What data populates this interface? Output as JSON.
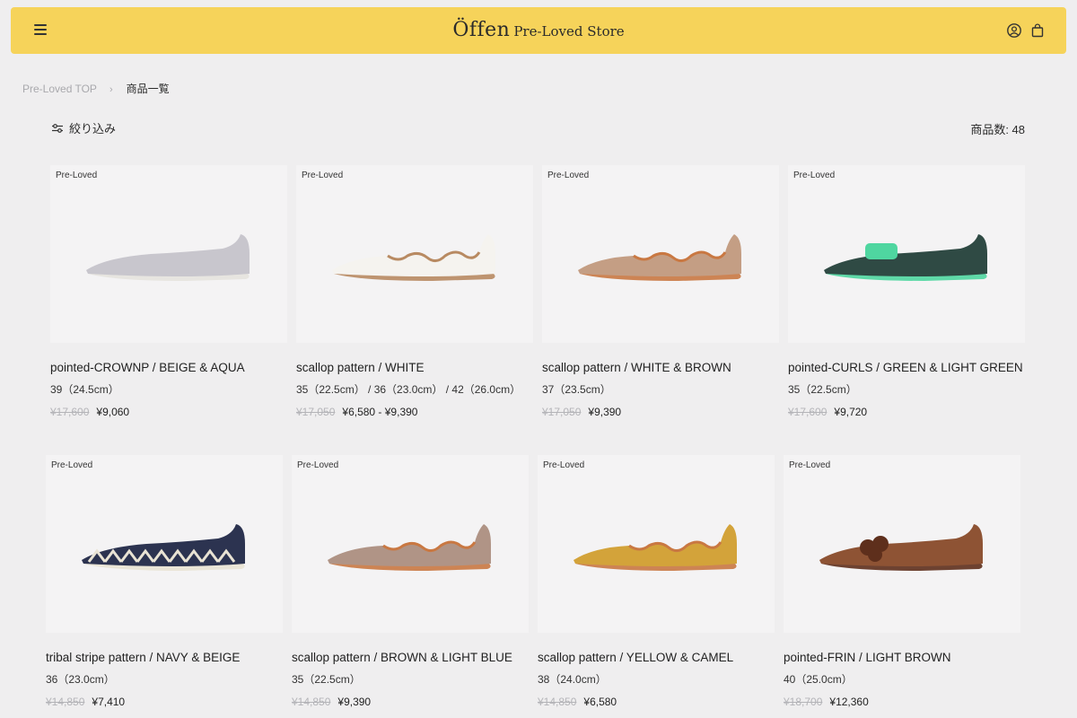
{
  "header": {
    "brand": "Öffen",
    "brand_sub": "Pre-Loved Store",
    "bg_color": "#f6d35a"
  },
  "breadcrumb": {
    "home": "Pre-Loved TOP",
    "separator": "›",
    "current": "商品一覧"
  },
  "toolbar": {
    "filter_label": "絞り込み",
    "count_label": "商品数: 48"
  },
  "products": [
    {
      "badge": "Pre-Loved",
      "title": "pointed-CROWNP / BEIGE & AQUA",
      "size": "39（24.5cm）",
      "old_price": "¥17,600",
      "price": "¥9,060",
      "color": "#c8c6cd",
      "accent": "#e6e3de"
    },
    {
      "badge": "Pre-Loved",
      "title": "scallop pattern / WHITE",
      "size": "35（22.5cm） / 36（23.0cm） / 42（26.0cm）",
      "old_price": "¥17,050",
      "price": "¥6,580 - ¥9,390",
      "color": "#f5f3ef",
      "accent": "#b88a62"
    },
    {
      "badge": "Pre-Loved",
      "title": "scallop pattern / WHITE & BROWN",
      "size": "37（23.5cm）",
      "old_price": "¥17,050",
      "price": "¥9,390",
      "color": "#c49e84",
      "accent": "#c97842"
    },
    {
      "badge": "Pre-Loved",
      "title": "pointed-CURLS / GREEN & LIGHT GREEN",
      "size": "35（22.5cm）",
      "old_price": "¥17,600",
      "price": "¥9,720",
      "color": "#2f4a44",
      "accent": "#4fd6a0"
    },
    {
      "badge": "Pre-Loved",
      "title": "tribal stripe pattern / NAVY & BEIGE",
      "size": "36（23.0cm）",
      "old_price": "¥14,850",
      "price": "¥7,410",
      "color": "#2c3350",
      "accent": "#e9e3d4"
    },
    {
      "badge": "Pre-Loved",
      "title": "scallop pattern / BROWN & LIGHT BLUE",
      "size": "35（22.5cm）",
      "old_price": "¥14,850",
      "price": "¥9,390",
      "color": "#b09486",
      "accent": "#c97842"
    },
    {
      "badge": "Pre-Loved",
      "title": "scallop pattern / YELLOW & CAMEL",
      "size": "38（24.0cm）",
      "old_price": "¥14,850",
      "price": "¥6,580",
      "color": "#d3a33a",
      "accent": "#c97842"
    },
    {
      "badge": "Pre-Loved",
      "title": "pointed-FRIN / LIGHT BROWN",
      "size": "40（25.0cm）",
      "old_price": "¥18,700",
      "price": "¥12,360",
      "color": "#8e5334",
      "accent": "#5e2f1c"
    }
  ]
}
